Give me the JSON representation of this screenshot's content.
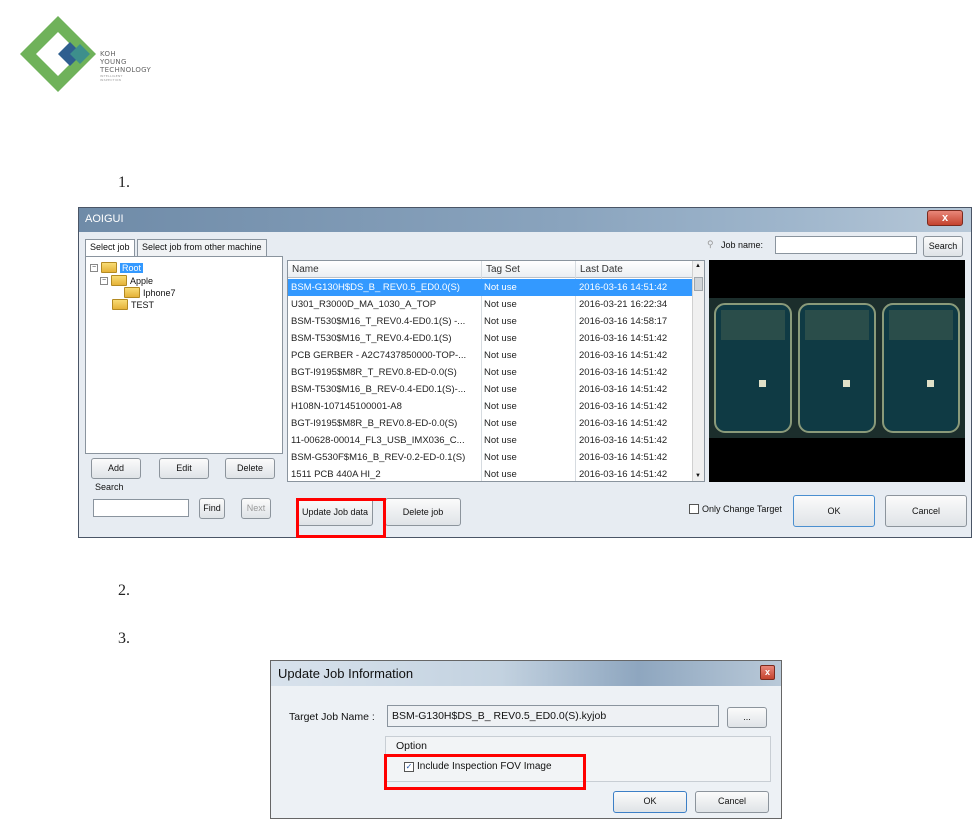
{
  "logo": {
    "line1": "KOH",
    "line2": "YOUNG",
    "line3": "TECHNOLOGY",
    "line4": "INTELLIGENT",
    "line5": "INSPECTION",
    "colors": {
      "green": "#6fb25a",
      "teal": "#3d8f8c",
      "blue": "#2f5f8f"
    }
  },
  "steps": {
    "s1": "1.",
    "s2": "2.",
    "s3": "3."
  },
  "main_window": {
    "title": "AOIGUI",
    "close_label": "x",
    "tabs": [
      "Select job",
      "Select job from other machine"
    ],
    "search_label": "Job name:",
    "search_value": "",
    "search_button": "Search",
    "tree": {
      "root": "Root",
      "apple": "Apple",
      "iphone": "Iphone7",
      "test": "TEST"
    },
    "tree_buttons": {
      "add": "Add",
      "edit": "Edit",
      "delete": "Delete"
    },
    "search_section_label": "Search",
    "find_button": "Find",
    "next_button": "Next",
    "columns": {
      "name": "Name",
      "tag": "Tag Set",
      "date": "Last Date"
    },
    "rows": [
      {
        "name": "BSM-G130H$DS_B_ REV0.5_ED0.0(S)",
        "tag": "Not use",
        "date": "2016-03-16 14:51:42"
      },
      {
        "name": "U301_R3000D_MA_1030_A_TOP",
        "tag": "Not use",
        "date": "2016-03-21 16:22:34"
      },
      {
        "name": "BSM-T530$M16_T_REV0.4-ED0.1(S) -...",
        "tag": "Not use",
        "date": "2016-03-16 14:58:17"
      },
      {
        "name": "BSM-T530$M16_T_REV0.4-ED0.1(S)",
        "tag": "Not use",
        "date": "2016-03-16 14:51:42"
      },
      {
        "name": "PCB GERBER - A2C7437850000-TOP-...",
        "tag": "Not use",
        "date": "2016-03-16 14:51:42"
      },
      {
        "name": "BGT-I9195$M8R_T_REV0.8-ED-0.0(S)",
        "tag": "Not use",
        "date": "2016-03-16 14:51:42"
      },
      {
        "name": "BSM-T530$M16_B_REV-0.4-ED0.1(S)-...",
        "tag": "Not use",
        "date": "2016-03-16 14:51:42"
      },
      {
        "name": "H108N-107145100001-A8",
        "tag": "Not use",
        "date": "2016-03-16 14:51:42"
      },
      {
        "name": "BGT-I9195$M8R_B_REV0.8-ED-0.0(S)",
        "tag": "Not use",
        "date": "2016-03-16 14:51:42"
      },
      {
        "name": "11-00628-00014_FL3_USB_IMX036_C...",
        "tag": "Not use",
        "date": "2016-03-16 14:51:42"
      },
      {
        "name": "BSM-G530F$M16_B_REV-0.2-ED-0.1(S)",
        "tag": "Not use",
        "date": "2016-03-16 14:51:42"
      },
      {
        "name": "1511 PCB 440A HI_2",
        "tag": "Not use",
        "date": "2016-03-16 14:51:42"
      }
    ],
    "update_button": "Update Job data",
    "delete_job_button": "Delete job",
    "only_change_target": "Only Change Target",
    "ok_button": "OK",
    "cancel_button": "Cancel"
  },
  "update_dialog": {
    "title": "Update Job Information",
    "close_label": "x",
    "target_label": "Target Job Name :",
    "target_value": "BSM-G130H$DS_B_ REV0.5_ED0.0(S).kyjob",
    "browse_button": "...",
    "option_label": "Option",
    "include_label": "Include Inspection FOV Image",
    "ok_button": "OK",
    "cancel_button": "Cancel"
  }
}
